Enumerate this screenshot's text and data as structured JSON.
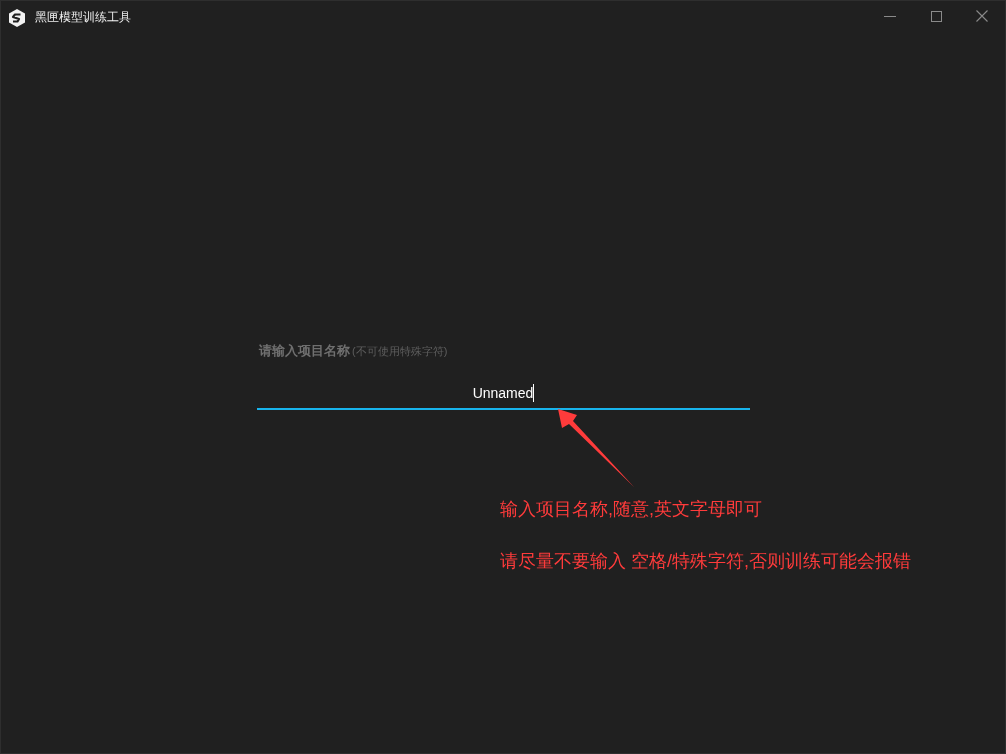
{
  "window": {
    "title": "黑匣模型训练工具"
  },
  "project_name_field": {
    "label": "请输入项目名称",
    "hint": "(不可使用特殊字符)",
    "value": "Unnamed",
    "focused": true
  },
  "annotation_notes": [
    "输入项目名称,随意,英文字母即可",
    "请尽量不要输入 空格/特殊字符,否则训练可能会报错"
  ]
}
